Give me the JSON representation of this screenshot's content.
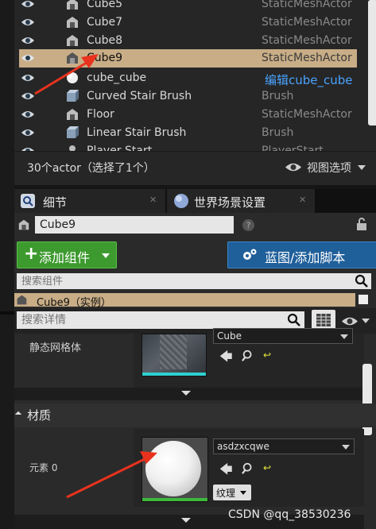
{
  "outliner": {
    "rows": [
      {
        "name": "Cube5",
        "type": "StaticMeshActor",
        "icon": "static-mesh-icon"
      },
      {
        "name": "Cube7",
        "type": "StaticMeshActor",
        "icon": "static-mesh-icon"
      },
      {
        "name": "Cube8",
        "type": "StaticMeshActor",
        "icon": "static-mesh-icon"
      },
      {
        "name": "Cube9",
        "type": "StaticMeshActor",
        "icon": "static-mesh-icon",
        "selected": true
      },
      {
        "name": "cube_cube",
        "type": "编辑cube_cube",
        "icon": "sphere-actor-icon",
        "type_is_link": true
      },
      {
        "name": "Curved Stair Brush",
        "type": "Brush",
        "icon": "brush-cube-icon"
      },
      {
        "name": "Floor",
        "type": "StaticMeshActor",
        "icon": "static-mesh-icon"
      },
      {
        "name": "Linear Stair Brush",
        "type": "Brush",
        "icon": "brush-cube-icon"
      },
      {
        "name": "Player Start",
        "type": "PlayerStart",
        "icon": "player-start-icon"
      }
    ],
    "footer_count": "30个actor（选择了1个）",
    "view_options": "视图选项"
  },
  "tabs": [
    {
      "label": "细节",
      "icon": "details-magnifier-icon"
    },
    {
      "label": "世界场景设置",
      "icon": "world-globe-icon"
    }
  ],
  "details": {
    "actor_name": "Cube9",
    "add_component": "添加组件",
    "blueprint_button": "蓝图/添加脚本",
    "search_components_placeholder": "搜索组件",
    "component_root": "Cube9（实例）",
    "search_details_placeholder": "搜索详情",
    "static_mesh_label": "静态网格体",
    "static_mesh_value": "Cube",
    "material_section": "材质",
    "element_label": "元素 0",
    "material_value": "asdzxcqwe",
    "texture_button": "纹理"
  },
  "watermark": "CSDN @qq_38530236",
  "colors": {
    "selection": "#c8ad86",
    "green_button": "#3d9a2e",
    "blue_button": "#1f5f9a",
    "link": "#4aa3ff",
    "arrow": "#e8321e"
  }
}
